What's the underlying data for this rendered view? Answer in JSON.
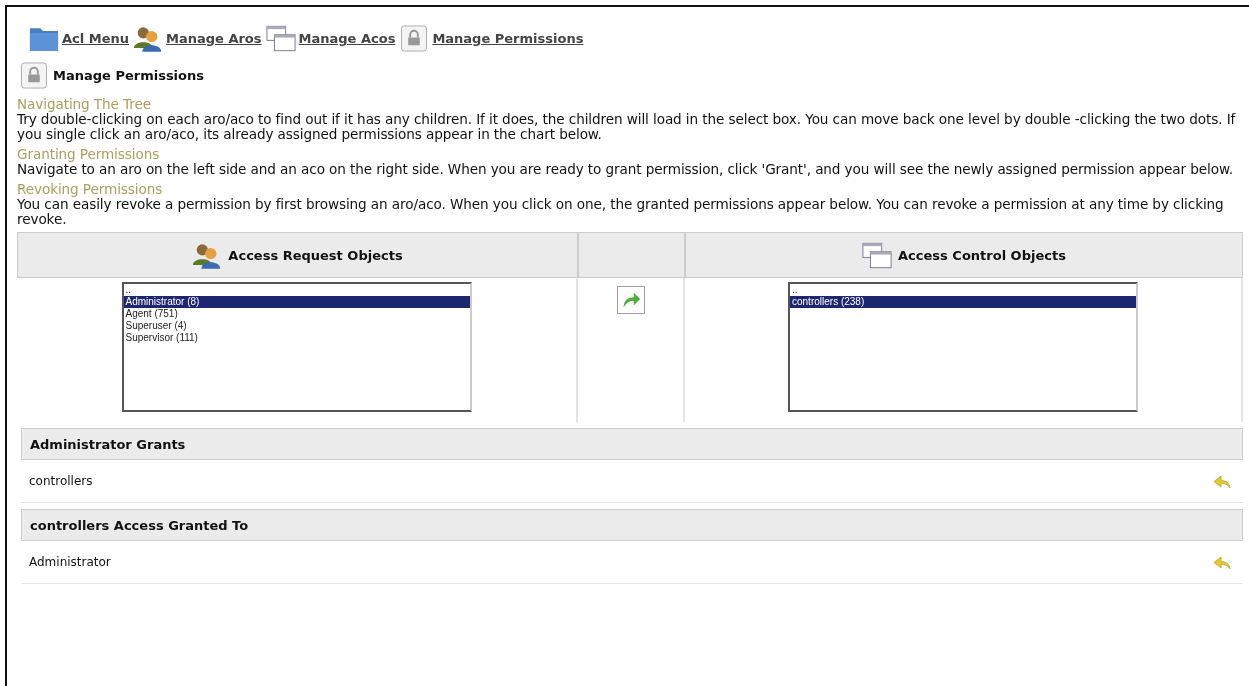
{
  "nav": [
    {
      "label": "Acl Menu"
    },
    {
      "label": "Manage Aros"
    },
    {
      "label": "Manage Acos"
    },
    {
      "label": "Manage Permissions"
    }
  ],
  "heading": "Manage Permissions",
  "sections": [
    {
      "title": "Navigating The Tree",
      "text": "Try double-clicking on each aro/aco to find out if it has any children. If it does, the children will load in the select box. You can move back one level by double -clicking the two dots. If you single click an aro/aco, its already assigned permissions appear in the chart below."
    },
    {
      "title": "Granting Permissions",
      "text": "Navigate to an aro on the left side and an aco on the right side. When you are ready to grant permission, click 'Grant', and you will see the newly assigned permission appear below."
    },
    {
      "title": "Revoking Permissions",
      "text": "You can easily revoke a permission by first browsing an aro/aco. When you click on one, the granted permissions appear below. You can revoke a permission at any time by clicking revoke."
    }
  ],
  "aro": {
    "title": "Access Request Objects",
    "items": [
      {
        "label": "..",
        "selected": false
      },
      {
        "label": "Administrator (8)",
        "selected": true
      },
      {
        "label": "Agent (751)",
        "selected": false
      },
      {
        "label": "Superuser (4)",
        "selected": false
      },
      {
        "label": "Supervisor (111)",
        "selected": false
      }
    ]
  },
  "aco": {
    "title": "Access Control Objects",
    "items": [
      {
        "label": "..",
        "selected": false
      },
      {
        "label": "controllers (238)",
        "selected": true
      }
    ]
  },
  "grant_tables": [
    {
      "title": "Administrator Grants",
      "rows": [
        "controllers"
      ]
    },
    {
      "title": "controllers Access Granted To",
      "rows": [
        "Administrator"
      ]
    }
  ]
}
